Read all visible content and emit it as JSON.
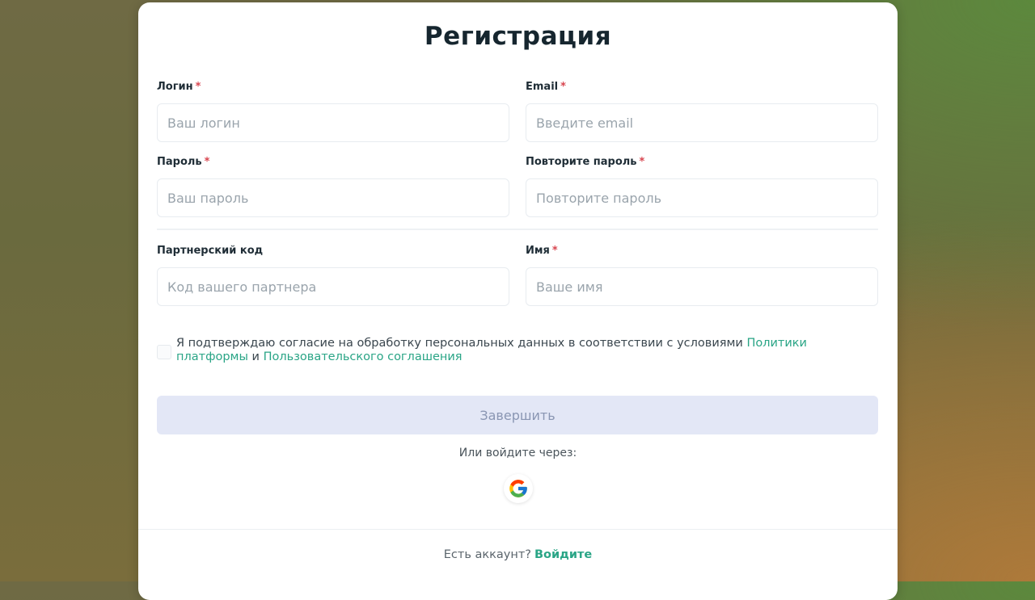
{
  "title": "Регистрация",
  "fields": {
    "login": {
      "label": "Логин",
      "required_mark": "*",
      "placeholder": "Ваш логин"
    },
    "email": {
      "label": "Email",
      "required_mark": "*",
      "placeholder": "Введите email"
    },
    "password": {
      "label": "Пароль",
      "required_mark": "*",
      "placeholder": "Ваш пароль"
    },
    "password_repeat": {
      "label": "Повторите пароль",
      "required_mark": "*",
      "placeholder": "Повторите пароль"
    },
    "partner_code": {
      "label": "Партнерский код",
      "placeholder": "Код вашего партнера"
    },
    "name": {
      "label": "Имя",
      "required_mark": "*",
      "placeholder": "Ваше имя"
    }
  },
  "consent": {
    "checked": false,
    "text_before": "Я подтверждаю согласие на обработку персональных данных в соответствии с условиями ",
    "policy_link": "Политики платформы",
    "text_middle": " и ",
    "agreement_link": "Пользовательского соглашения"
  },
  "submit_label": "Завершить",
  "social": {
    "prompt": "Или войдите через:",
    "google_icon": "google-g-logo"
  },
  "footer": {
    "question": "Есть аккаунт?",
    "login_link": "Войдите"
  },
  "colors": {
    "accent": "#2aa586",
    "required": "#d8454f",
    "submit_disabled_bg": "#e3e7f6",
    "title": "#16262f"
  }
}
